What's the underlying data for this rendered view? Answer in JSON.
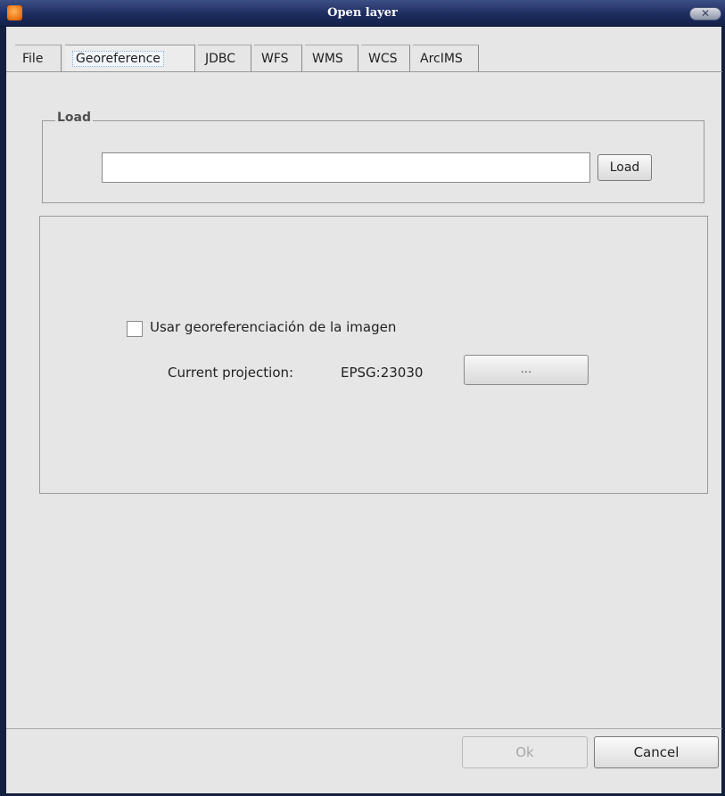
{
  "window": {
    "title": "Open layer",
    "close_icon": "close-icon"
  },
  "tabs": [
    {
      "label": "File",
      "active": false
    },
    {
      "label": "Georeference",
      "active": true
    },
    {
      "label": "JDBC",
      "active": false
    },
    {
      "label": "WFS",
      "active": false
    },
    {
      "label": "WMS",
      "active": false
    },
    {
      "label": "WCS",
      "active": false
    },
    {
      "label": "ArcIMS",
      "active": false
    }
  ],
  "load": {
    "legend": "Load",
    "input_value": "",
    "button_label": "Load"
  },
  "georef": {
    "checkbox_label": "Usar georeferenciación de la imagen",
    "checked": false,
    "projection_label": "Current projection:",
    "projection_value": "EPSG:23030",
    "projection_button": "..."
  },
  "footer": {
    "ok_label": "Ok",
    "ok_enabled": false,
    "cancel_label": "Cancel"
  },
  "colors": {
    "titlebar": "#1d2c5e",
    "window_bg": "#e6e6e6",
    "app_icon": "#f07a18"
  }
}
